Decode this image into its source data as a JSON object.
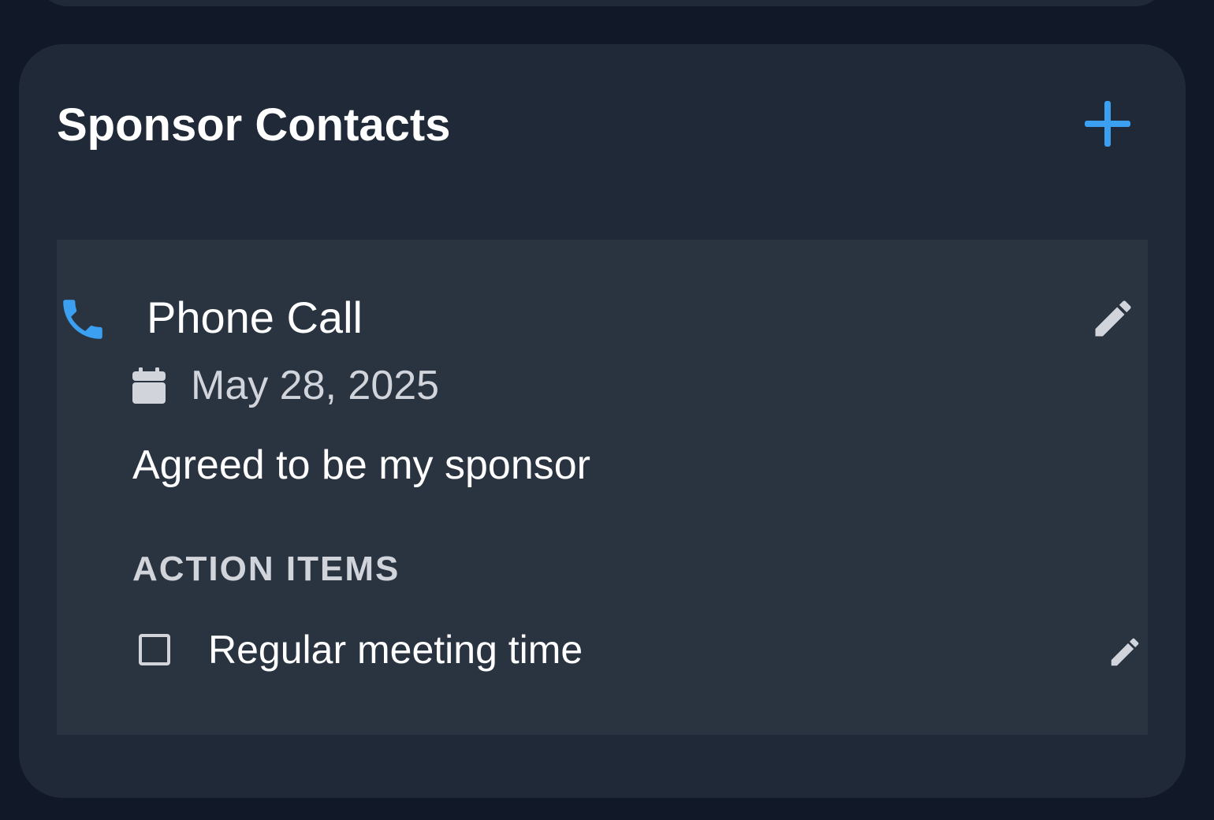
{
  "section": {
    "title": "Sponsor Contacts",
    "add_icon": "plus-icon",
    "accent_color": "#3ba0f2"
  },
  "contact": {
    "type": "Phone Call",
    "type_icon": "phone-icon",
    "edit_icon": "pencil-icon",
    "date_icon": "calendar-icon",
    "date": "May 28, 2025",
    "note": "Agreed to be my sponsor",
    "action_items_heading": "ACTION ITEMS",
    "action_items": [
      {
        "label": "Regular meeting time",
        "checked": false,
        "edit_icon": "pencil-icon"
      }
    ]
  }
}
